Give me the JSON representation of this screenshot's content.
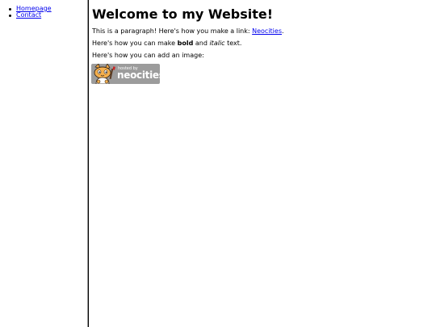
{
  "sidebar": {
    "items": [
      {
        "label": "Homepage"
      },
      {
        "label": "Contact"
      }
    ]
  },
  "main": {
    "title": "Welcome to my Website!",
    "paragraph1": {
      "before": "This is a paragraph! Here's how you make a link: ",
      "link": "Neocities",
      "after": "."
    },
    "paragraph2": {
      "before": "Here's how you can make ",
      "bold": "bold",
      "middle": " and ",
      "italic": "italic",
      "after": " text."
    },
    "paragraph3": "Here's how you can add an image:",
    "badge": {
      "small_text": "hosted by",
      "big_text": "neocities",
      "icon": "neocities-cat-mascot-icon"
    }
  },
  "colors": {
    "link": "#0000ee",
    "badge_bg": "#9c9c9c",
    "divider": "#000000"
  }
}
